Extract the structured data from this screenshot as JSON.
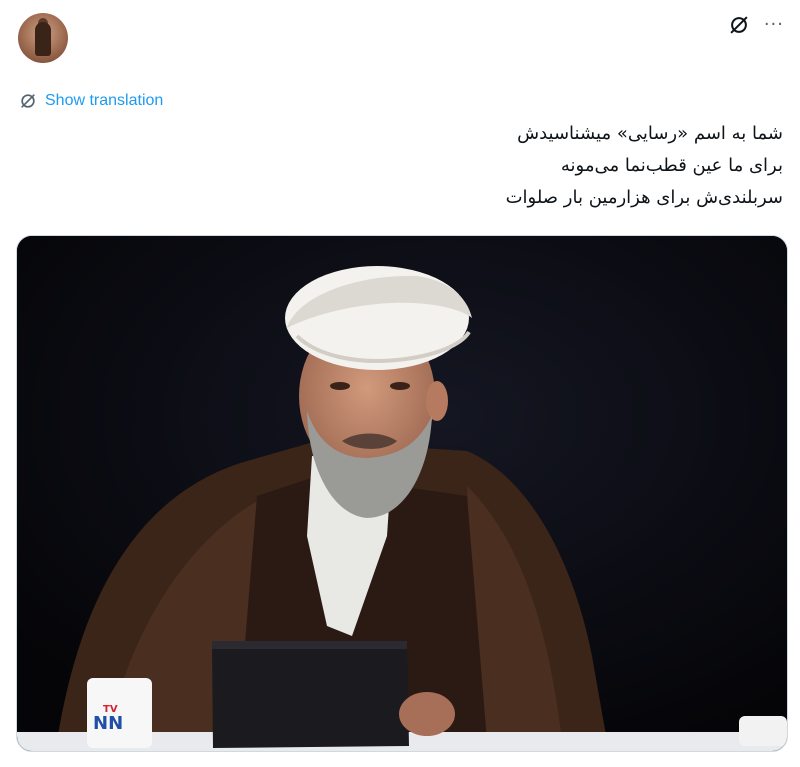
{
  "user": {
    "avatar_icon": "profile-avatar"
  },
  "actions": {
    "grok_icon": "grok-icon",
    "more_label": "···"
  },
  "translation": {
    "label": "Show translation"
  },
  "tweet": {
    "lines": [
      "شما به اسم «رسایی» میشناسیدش",
      "برای ما عین قطب‌نما می‌مونه",
      "سربلندی‌ش برای هزارمین بار صلوات"
    ]
  },
  "media": {
    "cup_logo_top": "TV",
    "cup_logo_main": "NN"
  },
  "colors": {
    "accent": "#1d9bf0",
    "text": "#0f1419",
    "muted": "#536471"
  }
}
